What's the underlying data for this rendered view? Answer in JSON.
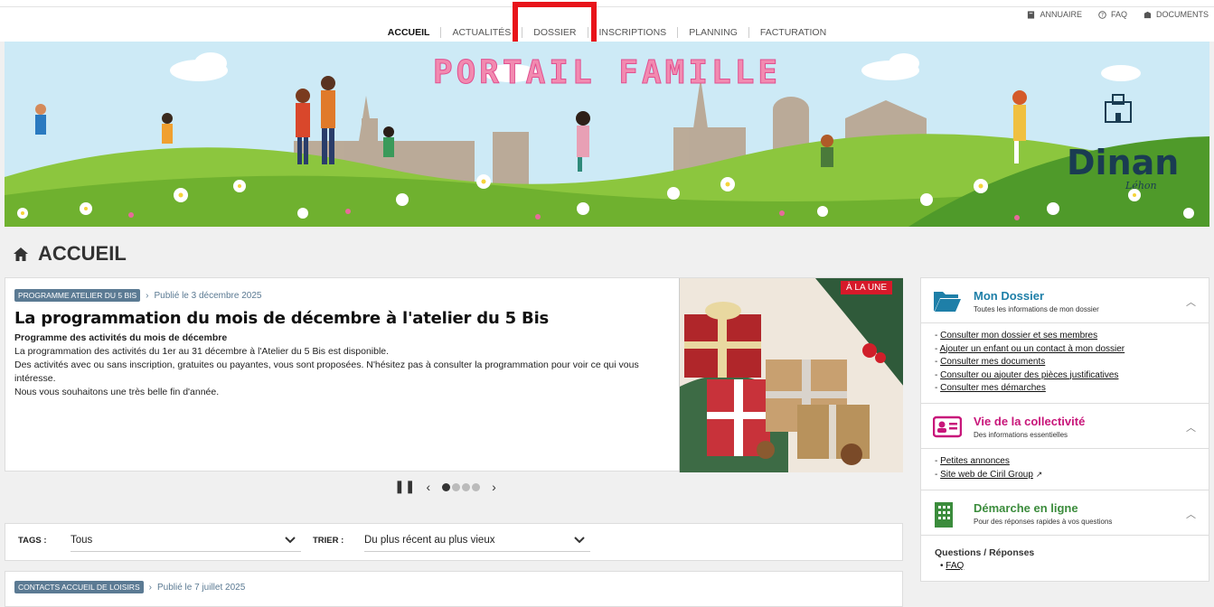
{
  "utility_nav": [
    {
      "icon": "address-book-icon",
      "label": "ANNUAIRE"
    },
    {
      "icon": "help-circle-icon",
      "label": "FAQ"
    },
    {
      "icon": "documents-icon",
      "label": "DOCUMENTS"
    }
  ],
  "main_nav": [
    {
      "label": "ACCUEIL",
      "active": true
    },
    {
      "label": "ACTUALITÉS",
      "active": false
    },
    {
      "label": "DOSSIER",
      "active": false
    },
    {
      "label": "INSCRIPTIONS",
      "active": false
    },
    {
      "label": "PLANNING",
      "active": false
    },
    {
      "label": "FACTURATION",
      "active": false
    }
  ],
  "highlight": {
    "target": "DOSSIER",
    "color": "#e8141a"
  },
  "banner": {
    "title": "PORTAIL FAMILLE",
    "logo_text": "Dinan",
    "logo_sub": "Léhon"
  },
  "page": {
    "icon": "home-icon",
    "title": "ACCUEIL"
  },
  "article": {
    "tag": "PROGRAMME ATELIER DU 5 BIS",
    "published": "Publié le 3 décembre 2025",
    "title": "La programmation du mois de décembre à l'atelier du 5 Bis",
    "subtitle": "Programme des activités du mois de décembre",
    "paragraphs": [
      "La programmation des activités du 1er au 31 décembre à l'Atelier du 5 Bis est disponible.",
      "Des activités avec ou sans inscription, gratuites ou payantes, vous sont proposées. N'hésitez pas à consulter la programmation pour voir ce qui vous intéresse.",
      "Nous vous souhaitons une très belle fin d'année."
    ],
    "badge": "À LA UNE"
  },
  "carousel": {
    "slides": 4,
    "current": 1
  },
  "filters": {
    "tags_label": "TAGS :",
    "tags_value": "Tous",
    "sort_label": "TRIER :",
    "sort_value": "Du plus récent au plus vieux"
  },
  "article2": {
    "tag": "CONTACTS ACCUEIL DE LOISIRS",
    "published": "Publié le 7 juillet 2025"
  },
  "sidebar": {
    "dossier": {
      "title": "Mon Dossier",
      "subtitle": "Toutes les informations de mon dossier",
      "links": [
        "Consulter mon dossier et ses membres",
        "Ajouter un enfant ou un contact à mon dossier",
        "Consulter mes documents",
        "Consulter ou ajouter des pièces justificatives",
        "Consulter mes démarches"
      ]
    },
    "collectivite": {
      "title": "Vie de la collectivité",
      "subtitle": "Des informations essentielles",
      "links": [
        "Petites annonces",
        "Site web de Ciril Group"
      ]
    },
    "demarche": {
      "title": "Démarche en ligne",
      "subtitle": "Pour des réponses rapides à vos questions",
      "qa_title": "Questions / Réponses",
      "qa_link": "FAQ"
    }
  },
  "colors": {
    "dossier": "#1e7fa8",
    "collectivite": "#c8167a",
    "demarche": "#3b8c3c",
    "tag": "#5b7a93"
  }
}
